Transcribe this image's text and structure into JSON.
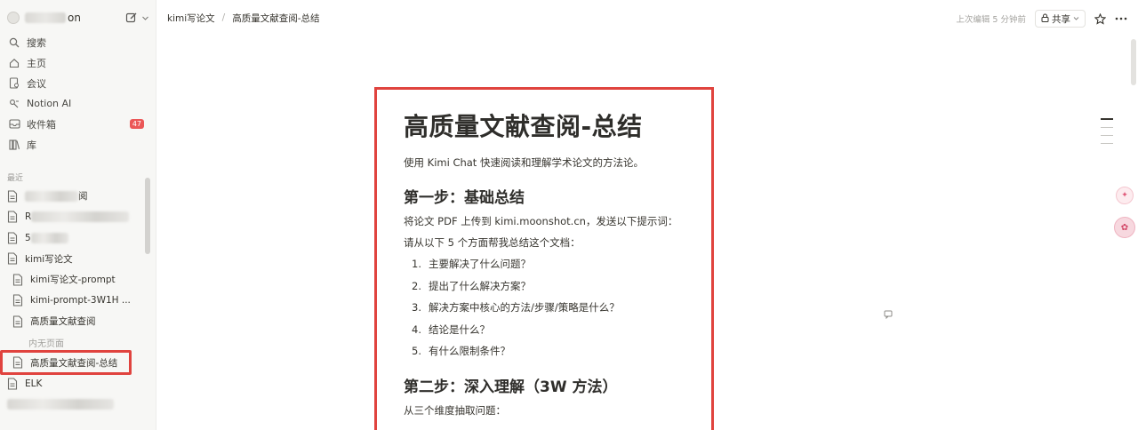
{
  "workspace": {
    "name_suffix": "on"
  },
  "nav": [
    {
      "label": "搜索",
      "icon": "search-icon"
    },
    {
      "label": "主页",
      "icon": "home-icon"
    },
    {
      "label": "会议",
      "icon": "meeting-icon"
    },
    {
      "label": "Notion AI",
      "icon": "notion-ai-icon"
    },
    {
      "label": "收件箱",
      "icon": "inbox-icon",
      "badge": "47"
    },
    {
      "label": "库",
      "icon": "library-icon"
    }
  ],
  "sidebar": {
    "section_label": "最近",
    "pages": [
      {
        "label": "阅"
      },
      {
        "label": "R"
      },
      {
        "label": "5"
      },
      {
        "label": "kimi写论文"
      },
      {
        "label": "kimi写论文-prompt"
      },
      {
        "label": "kimi-prompt-3W1H ..."
      },
      {
        "label": "高质量文献查阅"
      },
      {
        "label": "内无页面"
      },
      {
        "label": "高质量文献查阅-总结"
      },
      {
        "label": "ELK"
      }
    ]
  },
  "breadcrumb": {
    "parent": "kimi写论文",
    "separator": "/",
    "current": "高质量文献查阅-总结"
  },
  "topbar": {
    "edited": "上次编辑 5 分钟前",
    "share_label": "共享"
  },
  "document": {
    "title": "高质量文献查阅-总结",
    "subtitle": "使用 Kimi Chat 快速阅读和理解学术论文的方法论。",
    "step1": {
      "heading": "第一步：基础总结",
      "line1": "将论文 PDF 上传到 kimi.moonshot.cn，发送以下提示词：",
      "line2": "请从以下 5 个方面帮我总结这个文档：",
      "items": [
        {
          "num": "1.",
          "text": "主要解决了什么问题？"
        },
        {
          "num": "2.",
          "text": "提出了什么解决方案？"
        },
        {
          "num": "3.",
          "text": "解决方案中核心的方法/步骤/策略是什么？"
        },
        {
          "num": "4.",
          "text": "结论是什么？"
        },
        {
          "num": "5.",
          "text": "有什么限制条件？"
        }
      ]
    },
    "step2": {
      "heading": "第二步：深入理解（3W 方法）",
      "line1": "从三个维度抽取问题："
    }
  },
  "colors": {
    "highlight_border": "#e0433e",
    "sidebar_bg": "#f7f7f5",
    "badge": "#eb5757"
  }
}
